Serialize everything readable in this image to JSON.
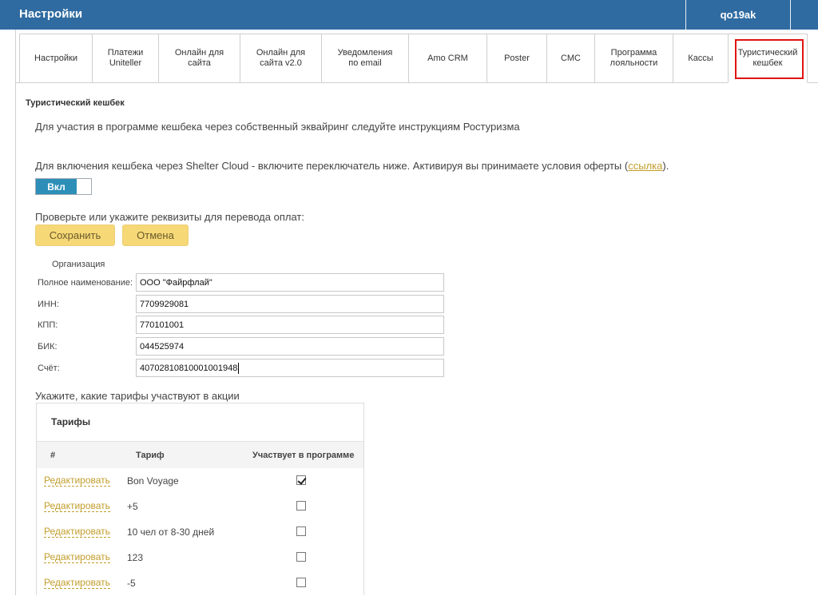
{
  "header": {
    "title": "Настройки",
    "user": "qo19ak"
  },
  "tabs": [
    {
      "label": "Настройки"
    },
    {
      "label": "Платежи\nUniteller"
    },
    {
      "label": "Онлайн для\nсайта"
    },
    {
      "label": "Онлайн для\nсайта v2.0"
    },
    {
      "label": "Уведомления\nпо email"
    },
    {
      "label": "Amo CRM"
    },
    {
      "label": "Poster"
    },
    {
      "label": "СМС"
    },
    {
      "label": "Программа\nлояльности"
    },
    {
      "label": "Кассы"
    },
    {
      "label": "Туристический\nкешбек"
    }
  ],
  "section": {
    "title": "Туристический кешбек",
    "intro": "Для участия в программе кешбека через собственный эквайринг следуйте инструкциям Ростуризма",
    "enable_text": "Для включения кешбека через Shelter Cloud - включите переключатель ниже. Активируя вы принимаете условия оферты (",
    "enable_link": "ссылка",
    "enable_end": ").",
    "toggle_label": "Вкл",
    "requisites_text": "Проверьте или укажите реквизиты для перевода оплат:",
    "save_label": "Сохранить",
    "cancel_label": "Отмена"
  },
  "organization": {
    "label": "Организация",
    "fields": [
      {
        "label": "Полное наименование:",
        "value": "ООО \"Файрфлай\""
      },
      {
        "label": "ИНН:",
        "value": "7709929081"
      },
      {
        "label": "КПП:",
        "value": "770101001"
      },
      {
        "label": "БИК:",
        "value": "044525974"
      },
      {
        "label": "Счёт:",
        "value": "40702810810001001948"
      }
    ]
  },
  "tariffs": {
    "prompt": "Укажите, какие тарифы участвуют в акции",
    "caption": "Тарифы",
    "columns": {
      "num": "#",
      "tariff": "Тариф",
      "participates": "Участвует в программе"
    },
    "edit_label": "Редактировать",
    "rows": [
      {
        "name": "Bon Voyage",
        "checked": true
      },
      {
        "name": "+5",
        "checked": false
      },
      {
        "name": "10 чел от 8-30 дней",
        "checked": false
      },
      {
        "name": "123",
        "checked": false
      },
      {
        "name": "-5",
        "checked": false
      }
    ]
  },
  "colors": {
    "header": "#2f6ba0",
    "toggle_on": "#2d8fb8",
    "button": "#f6d877",
    "link": "#c29d2a",
    "highlight": "#e01313"
  }
}
